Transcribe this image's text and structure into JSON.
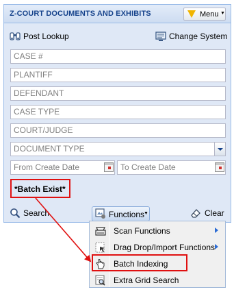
{
  "header": {
    "title": "Z-COURT DOCUMENTS AND EXHIBITS",
    "menu_label": "Menu"
  },
  "toolbar": {
    "post_lookup_label": "Post Lookup",
    "change_system_label": "Change System"
  },
  "fields": {
    "case_number": {
      "placeholder": "CASE #",
      "value": ""
    },
    "plaintiff": {
      "placeholder": "PLANTIFF",
      "value": ""
    },
    "defendant": {
      "placeholder": "DEFENDANT",
      "value": ""
    },
    "case_type": {
      "placeholder": "CASE TYPE",
      "value": ""
    },
    "court_judge": {
      "placeholder": "COURT/JUDGE",
      "value": ""
    },
    "document_type": {
      "placeholder": "DOCUMENT TYPE",
      "value": ""
    },
    "from_create_date": {
      "placeholder": "From Create Date",
      "value": ""
    },
    "to_create_date": {
      "placeholder": "To Create Date",
      "value": ""
    }
  },
  "batch_status": "*Batch Exist*",
  "actions": {
    "search_label": "Search",
    "functions_label": "Functions",
    "clear_label": "Clear"
  },
  "functions_menu": [
    {
      "label": "Scan Functions",
      "icon": "scanner-icon",
      "has_submenu": true
    },
    {
      "label": "Drag Drop/Import Functions",
      "icon": "import-icon",
      "has_submenu": true
    },
    {
      "label": "Batch Indexing",
      "icon": "hand-pointer-icon",
      "has_submenu": false
    },
    {
      "label": "Extra Grid Search",
      "icon": "grid-search-icon",
      "has_submenu": false
    }
  ],
  "colors": {
    "panel_bg": "#dfe8f6",
    "header_text": "#15428b",
    "highlight": "#e01010",
    "menu_flag": "#f0b400"
  }
}
